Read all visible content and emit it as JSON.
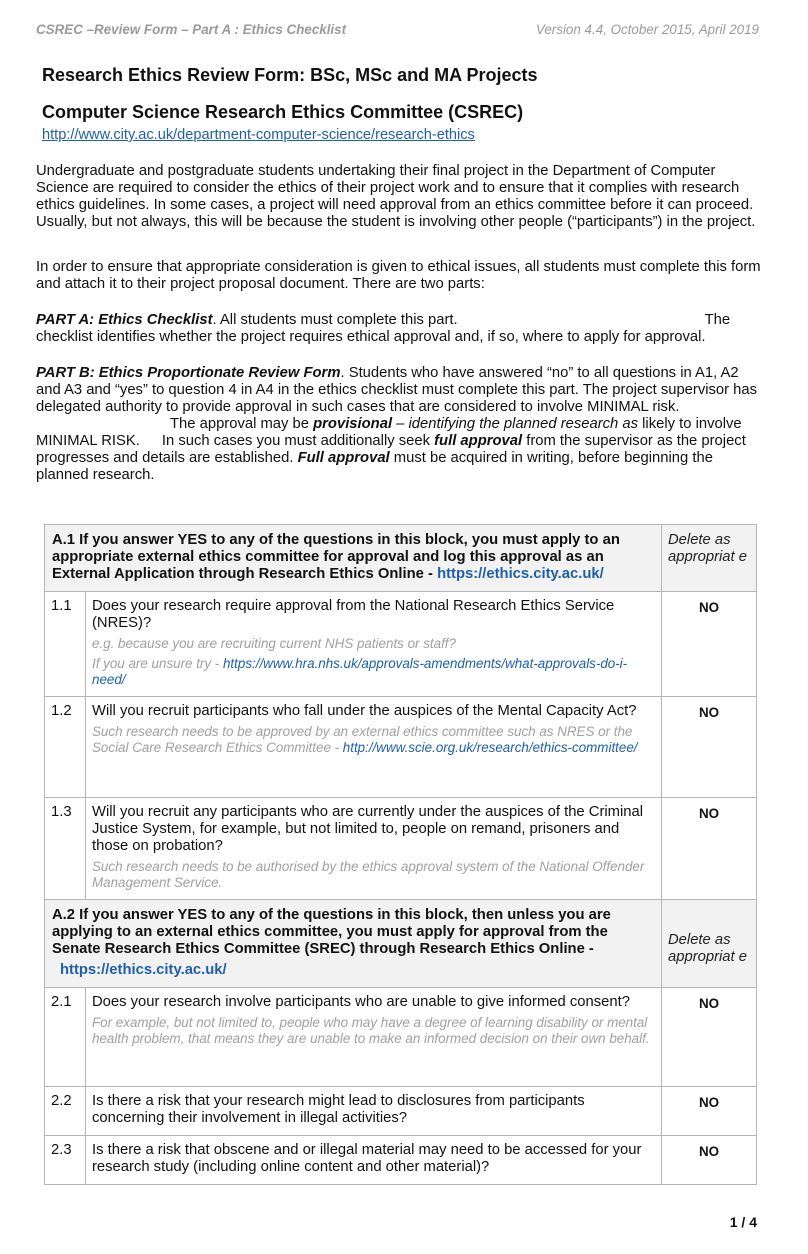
{
  "header": {
    "left": "CSREC –Review Form – Part A : Ethics Checklist",
    "right": "Version 4.4, October 2015, April 2019"
  },
  "title1": "Research Ethics Review Form: BSc, MSc and MA Projects",
  "title2": "Computer Science Research Ethics Committee (CSREC)",
  "url": "http://www.city.ac.uk/department-computer-science/research-ethics",
  "intro1": "Undergraduate and postgraduate students undertaking their final project in the Department of Computer Science are required to consider the ethics of their project work and to ensure that it complies with research ethics guidelines.  In some cases, a project will need approval from an ethics committee before it can proceed.  Usually, but not always, this will be because the student is involving other people (“participants”) in the project.",
  "intro2": "In order to ensure that appropriate consideration is given to ethical issues, all students must complete this form and attach it to their project proposal document. There are two parts:",
  "partA": {
    "label": "PART A: Ethics Checklist",
    "text1": ". All students must complete this part.",
    "text2": "The checklist identifies whether the project requires ethical approval and, if so, where to apply for approval."
  },
  "partB": {
    "label": "PART B: Ethics Proportionate Review Form",
    "text1": ". Students who have answered “no” to all questions in A1, A2 and A3 and “yes” to question 4 in A4 in the ethics checklist must complete this part. The project supervisor has delegated authority to provide approval in such cases that are considered to involve MINIMAL risk.",
    "text2": "The approval may be ",
    "provisional": "provisional",
    "text3": " – identifying the planned research as",
    "text4": " likely to involve MINIMAL RISK.",
    "text5": "In such cases you must additionally seek ",
    "full1": "full approval",
    "text6": " from the supervisor as the project progresses and details are established. ",
    "full2": "Full approval",
    "text7": " must be acquired in writing, before beginning the planned research."
  },
  "table": {
    "a1": {
      "text": "A.1 If you answer YES to any of the questions in this block, you must apply to an appropriate external ethics committee for approval and log this approval as an External Application through Research Ethics Online - ",
      "link": "https://ethics.city.ac.uk/",
      "delete": "Delete as appropriat e"
    },
    "q11": {
      "num": "1.1",
      "text": "Does your research require approval from the National Research Ethics Service (NRES)?",
      "hint1": "e.g. because you are recruiting current NHS patients or staff?",
      "hint2": "If you are unsure try - ",
      "hint2_link": "https://www.hra.nhs.uk/approvals-amendments/what-approvals-do-i-need/",
      "answer": "NO"
    },
    "q12": {
      "num": "1.2",
      "text": "Will you recruit participants who fall under the auspices of the Mental Capacity Act?",
      "hint": "Such research needs to be approved by an external ethics committee such as NRES or the Social Care Research Ethics Committee - ",
      "hint_link": "http://www.scie.org.uk/research/ethics-committee/",
      "answer": "NO"
    },
    "q13": {
      "num": "1.3",
      "text": "Will you recruit any participants who are currently under the auspices of the Criminal Justice System, for example, but not limited to, people on remand, prisoners and those on probation?",
      "hint": "Such research needs to be authorised by the ethics approval system of the National Offender Management Service.",
      "answer": "NO"
    },
    "a2": {
      "text": "A.2 If you answer YES to any of the questions in this block, then unless you are applying to an external ethics committee, you must apply for approval from the Senate Research Ethics Committee (SREC) through Research Ethics Online -",
      "link": "https://ethics.city.ac.uk/",
      "delete": "Delete as appropriat e"
    },
    "q21": {
      "num": "2.1",
      "text": "Does your research involve participants who are unable to give informed consent?",
      "hint": "For example, but not limited to, people who may have a degree of learning disability or mental health problem, that means they are unable to make an informed decision on their own behalf.",
      "answer": "NO"
    },
    "q22": {
      "num": "2.2",
      "text": "Is there a risk that your research might lead to disclosures from participants concerning their involvement in illegal activities?",
      "answer": "NO"
    },
    "q23": {
      "num": "2.3",
      "text": "Is there a risk that obscene and or illegal material may need to be accessed for your research study (including online content and other material)?",
      "answer": "NO"
    }
  },
  "page_number": "1 / 4"
}
